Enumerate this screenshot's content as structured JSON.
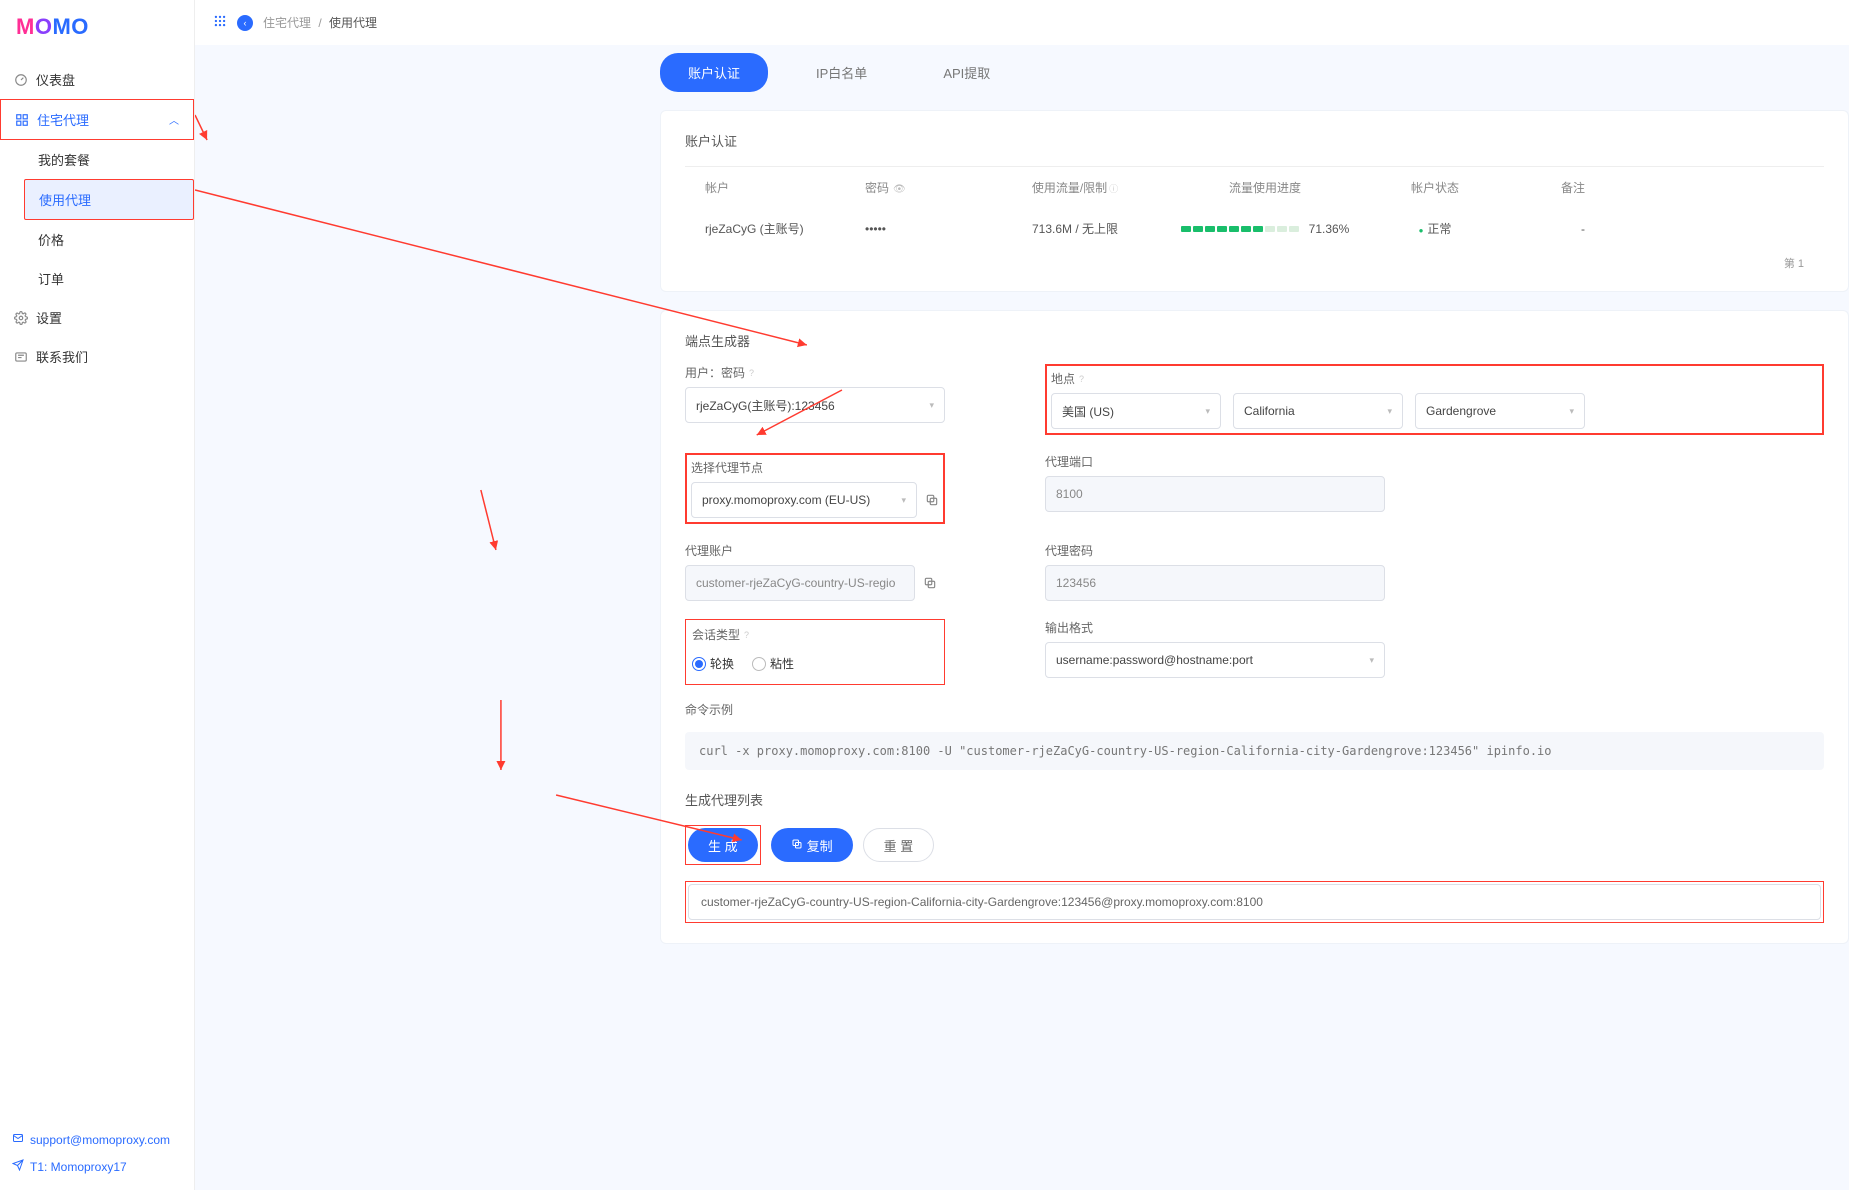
{
  "breadcrumb": {
    "parent": "住宅代理",
    "current": "使用代理"
  },
  "sidebar": {
    "dashboard": "仪表盘",
    "proxy": "住宅代理",
    "my_plan": "我的套餐",
    "use_proxy": "使用代理",
    "price": "价格",
    "orders": "订单",
    "settings": "设置",
    "contact": "联系我们",
    "support_email": "support@momoproxy.com",
    "telegram": "T1: Momoproxy17"
  },
  "tabs": {
    "auth": "账户认证",
    "whitelist": "IP白名单",
    "api": "API提取"
  },
  "account_auth": {
    "title": "账户认证",
    "cols": {
      "account": "帐户",
      "password": "密码",
      "usage": "使用流量/限制",
      "progress": "流量使用进度",
      "status": "帐户状态",
      "remark": "备注"
    },
    "row": {
      "account": "rjeZaCyG (主账号)",
      "password": "•••••",
      "usage": "713.6M / 无上限",
      "percent": "71.36%",
      "status": "正常",
      "remark": "-"
    },
    "pager": "第 1"
  },
  "gen": {
    "title": "端点生成器",
    "lbl_user": "用户：密码",
    "user_value": "rjeZaCyG(主账号):123456",
    "lbl_location": "地点",
    "country": "美国 (US)",
    "state": "California",
    "city": "Gardengrove",
    "lbl_node": "选择代理节点",
    "node_value": "proxy.momoproxy.com (EU-US)",
    "lbl_port": "代理端口",
    "port_value": "8100",
    "lbl_proxy_user": "代理账户",
    "proxy_user_value": "customer-rjeZaCyG-country-US-regio",
    "lbl_proxy_pw": "代理密码",
    "proxy_pw_value": "123456",
    "lbl_session": "会话类型",
    "session_rotate": "轮换",
    "session_sticky": "粘性",
    "lbl_format": "输出格式",
    "format_value": "username:password@hostname:port",
    "lbl_cmd": "命令示例",
    "cmd_value": "curl -x proxy.momoproxy.com:8100 -U \"customer-rjeZaCyG-country-US-region-California-city-Gardengrove:123456\" ipinfo.io",
    "lbl_list": "生成代理列表",
    "btn_generate": "生 成",
    "btn_copy": "复制",
    "btn_reset": "重 置",
    "result": "customer-rjeZaCyG-country-US-region-California-city-Gardengrove:123456@proxy.momoproxy.com:8100"
  }
}
